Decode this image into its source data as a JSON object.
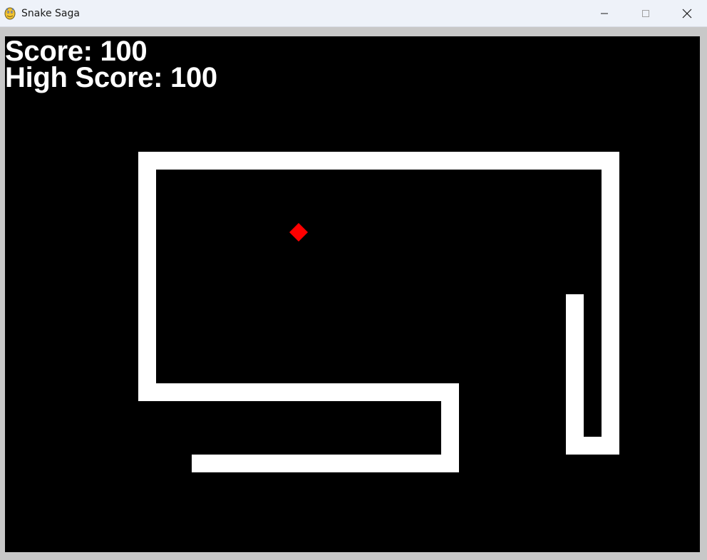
{
  "window": {
    "title": "Snake Saga",
    "icon": "pygame-snake-icon",
    "controls": {
      "minimize": "minimize-icon",
      "maximize": "maximize-icon",
      "close": "close-icon"
    }
  },
  "hud": {
    "score_label": "Score:",
    "score_value": "100",
    "high_score_label": "High Score:",
    "high_score_value": "100"
  },
  "colors": {
    "background": "#000000",
    "snake": "#ffffff",
    "food": "#ff0000",
    "hud_text": "#ffffff"
  }
}
